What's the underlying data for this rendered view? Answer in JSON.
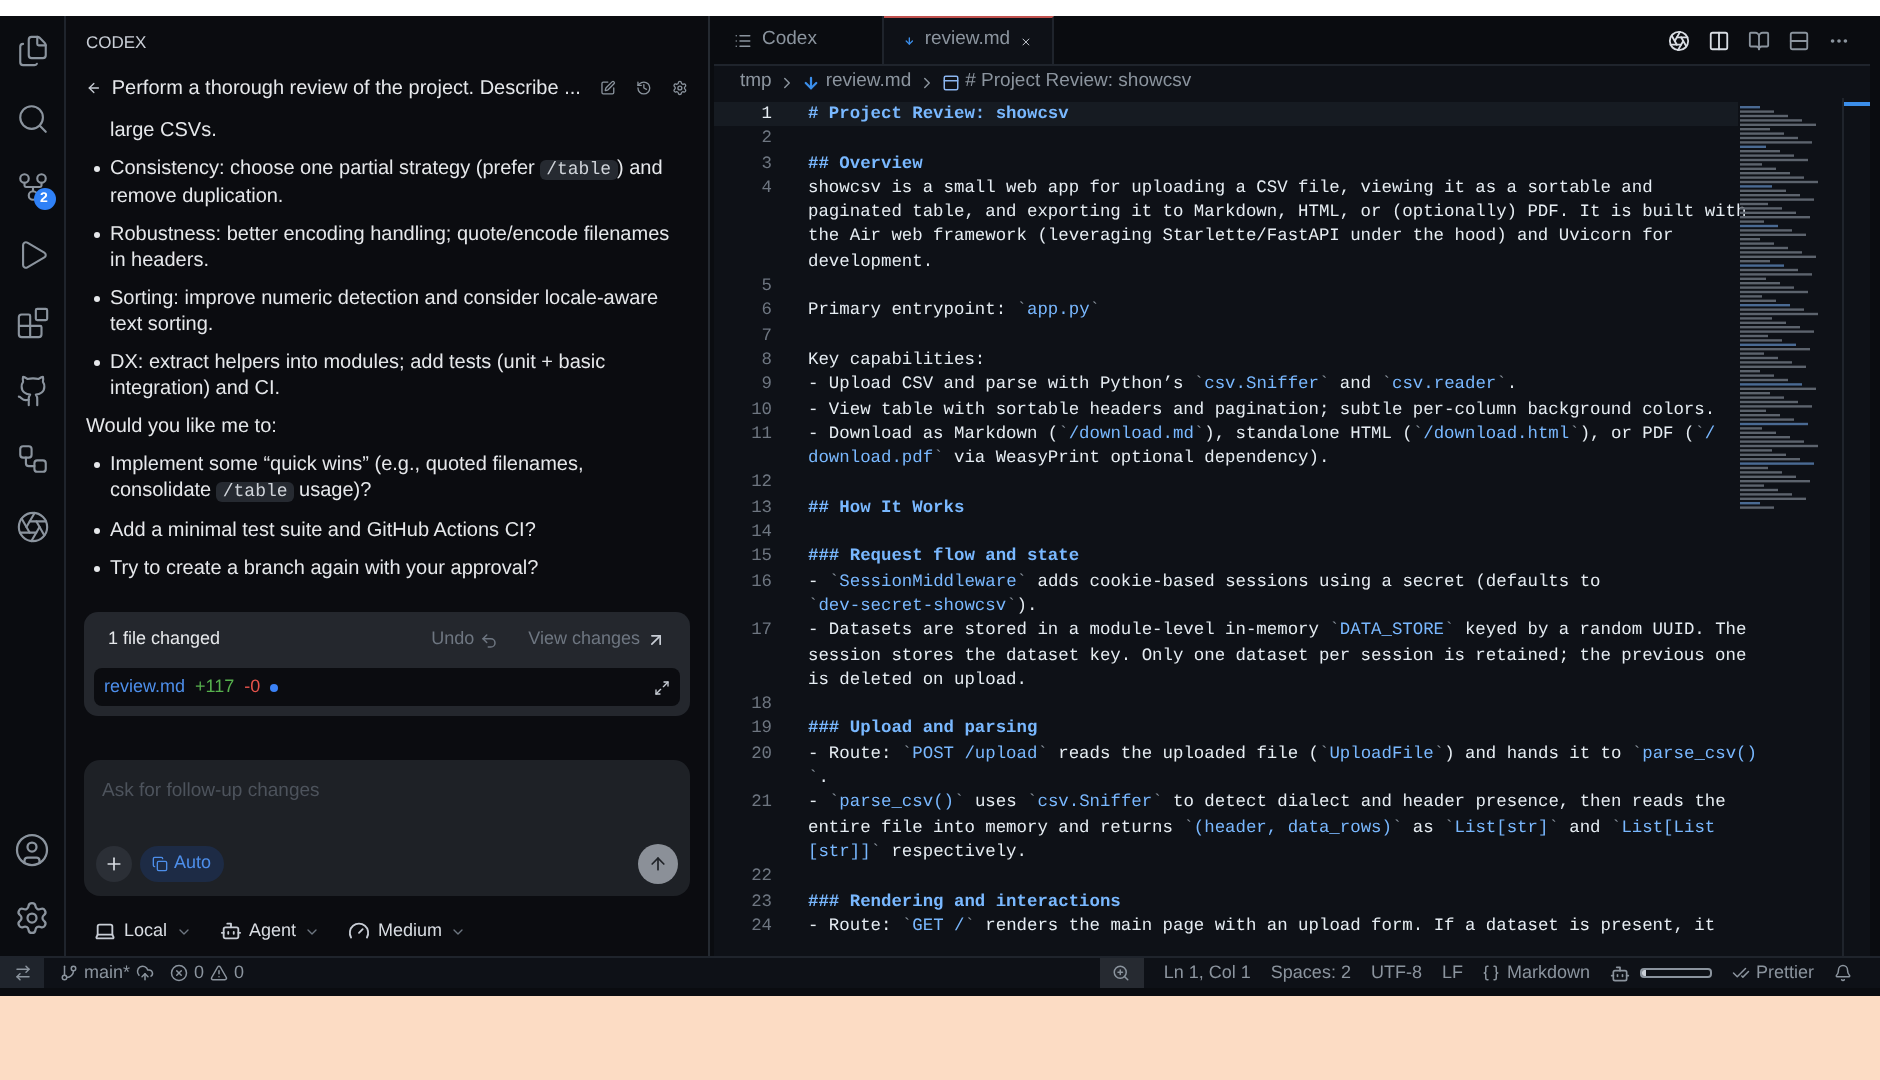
{
  "activity_bar": {
    "source_control_badge": "2"
  },
  "codex": {
    "header": "CODEX",
    "title": "Perform a thorough review of the project. Describe ...",
    "messages": [
      {
        "kind": "continuation",
        "parts": [
          {
            "text": "large CSVs."
          }
        ]
      },
      {
        "kind": "bullet",
        "parts": [
          {
            "text": "Consistency: choose one partial strategy (prefer "
          },
          {
            "code": "/table"
          },
          {
            "text": ") and remove duplication."
          }
        ]
      },
      {
        "kind": "bullet",
        "parts": [
          {
            "text": "Robustness: better encoding handling; quote/encode filenames in headers."
          }
        ]
      },
      {
        "kind": "bullet",
        "parts": [
          {
            "text": "Sorting: improve numeric detection and consider locale-aware text sorting."
          }
        ]
      },
      {
        "kind": "bullet",
        "parts": [
          {
            "text": "DX: extract helpers into modules; add tests (unit + basic integration) and CI."
          }
        ]
      },
      {
        "kind": "paragraph",
        "parts": [
          {
            "text": "Would you like me to:"
          }
        ]
      },
      {
        "kind": "bullet",
        "parts": [
          {
            "text": "Implement some “quick wins” (e.g., quoted filenames, consolidate "
          },
          {
            "code": "/table"
          },
          {
            "text": " usage)?"
          }
        ]
      },
      {
        "kind": "bullet",
        "parts": [
          {
            "text": "Add a minimal test suite and GitHub Actions CI?"
          }
        ]
      },
      {
        "kind": "bullet",
        "parts": [
          {
            "text": "Try to create a branch again with your approval?"
          }
        ]
      }
    ],
    "changes_card": {
      "summary": "1 file changed",
      "undo": "Undo",
      "view": "View changes",
      "file": "review.md",
      "added": "+117",
      "removed": "-0"
    },
    "composer": {
      "placeholder": "Ask for follow-up changes",
      "mode": "Auto"
    },
    "options": [
      {
        "kind": "local",
        "label": "Local"
      },
      {
        "kind": "agent",
        "label": "Agent"
      },
      {
        "kind": "reasoning",
        "label": "Medium"
      }
    ]
  },
  "editor": {
    "tabs": [
      {
        "kind": "codex",
        "label": "Codex",
        "selected": false
      },
      {
        "kind": "markdown",
        "label": "review.md",
        "selected": true
      }
    ],
    "breadcrumb": [
      "tmp",
      "review.md",
      "# Project Review: showcsv"
    ],
    "lines": [
      {
        "number": "1",
        "kind": "heading",
        "current": true,
        "rows": [
          "# Project Review: showcsv"
        ]
      },
      {
        "number": "2",
        "kind": "blank",
        "current": false
      },
      {
        "number": "3",
        "kind": "heading",
        "current": false,
        "rows": [
          "## Overview"
        ]
      },
      {
        "number": "4",
        "kind": "text",
        "current": false,
        "rows": [
          "showcsv is a small web app for uploading a CSV file, viewing it as a sortable and",
          "paginated table, and exporting it to Markdown, HTML, or (optionally) PDF. It is built with",
          "the Air web framework (leveraging Starlette/FastAPI under the hood) and Uvicorn for",
          "development."
        ]
      },
      {
        "number": "5",
        "kind": "blank",
        "current": false
      },
      {
        "number": "6",
        "kind": "text",
        "current": false,
        "rows": [
          "Primary entrypoint: `app.py`"
        ]
      },
      {
        "number": "7",
        "kind": "blank",
        "current": false
      },
      {
        "number": "8",
        "kind": "text",
        "current": false,
        "rows": [
          "Key capabilities:"
        ]
      },
      {
        "number": "9",
        "kind": "text",
        "current": false,
        "rows": [
          "- Upload CSV and parse with Python’s `csv.Sniffer` and `csv.reader`."
        ]
      },
      {
        "number": "10",
        "kind": "text",
        "current": false,
        "rows": [
          "- View table with sortable headers and pagination; subtle per-column background colors."
        ]
      },
      {
        "number": "11",
        "kind": "text",
        "current": false,
        "rows": [
          "- Download as Markdown (`/download.md`), standalone HTML (`/download.html`), or PDF (`/",
          "download.pdf` via WeasyPrint optional dependency)."
        ]
      },
      {
        "number": "12",
        "kind": "blank",
        "current": false
      },
      {
        "number": "13",
        "kind": "heading",
        "current": false,
        "rows": [
          "## How It Works"
        ]
      },
      {
        "number": "14",
        "kind": "blank",
        "current": false
      },
      {
        "number": "15",
        "kind": "heading",
        "current": false,
        "rows": [
          "### Request flow and state"
        ]
      },
      {
        "number": "16",
        "kind": "text",
        "current": false,
        "rows": [
          "- `SessionMiddleware` adds cookie-based sessions using a secret (defaults to",
          "`dev-secret-showcsv`)."
        ]
      },
      {
        "number": "17",
        "kind": "text",
        "current": false,
        "rows": [
          "- Datasets are stored in a module-level in-memory `DATA_STORE` keyed by a random UUID. The",
          "session stores the dataset key. Only one dataset per session is retained; the previous one",
          "is deleted on upload."
        ]
      },
      {
        "number": "18",
        "kind": "blank",
        "current": false
      },
      {
        "number": "19",
        "kind": "heading",
        "current": false,
        "rows": [
          "### Upload and parsing"
        ]
      },
      {
        "number": "20",
        "kind": "text",
        "current": false,
        "rows": [
          "- Route: `POST /upload` reads the uploaded file (`UploadFile`) and hands it to `parse_csv()",
          "`."
        ]
      },
      {
        "number": "21",
        "kind": "text",
        "current": false,
        "rows": [
          "- `parse_csv()` uses `csv.Sniffer` to detect dialect and header presence, then reads the",
          "entire file into memory and returns `(header, data_rows)` as `List[str]` and `List[List",
          "[str]]` respectively."
        ]
      },
      {
        "number": "22",
        "kind": "blank",
        "current": false
      },
      {
        "number": "23",
        "kind": "heading",
        "current": false,
        "rows": [
          "### Rendering and interactions"
        ]
      },
      {
        "number": "24",
        "kind": "text",
        "current": false,
        "rows": [
          "- Route: `GET /` renders the main page with an upload form. If a dataset is present, it"
        ]
      }
    ]
  },
  "status_bar": {
    "branch": "main*",
    "errors": "0",
    "warnings": "0",
    "cursor": "Ln 1, Col 1",
    "indent": "Spaces: 2",
    "encoding": "UTF-8",
    "eol": "LF",
    "language": "Markdown",
    "quota": {
      "level": 0.05
    },
    "formatter": "Prettier"
  }
}
